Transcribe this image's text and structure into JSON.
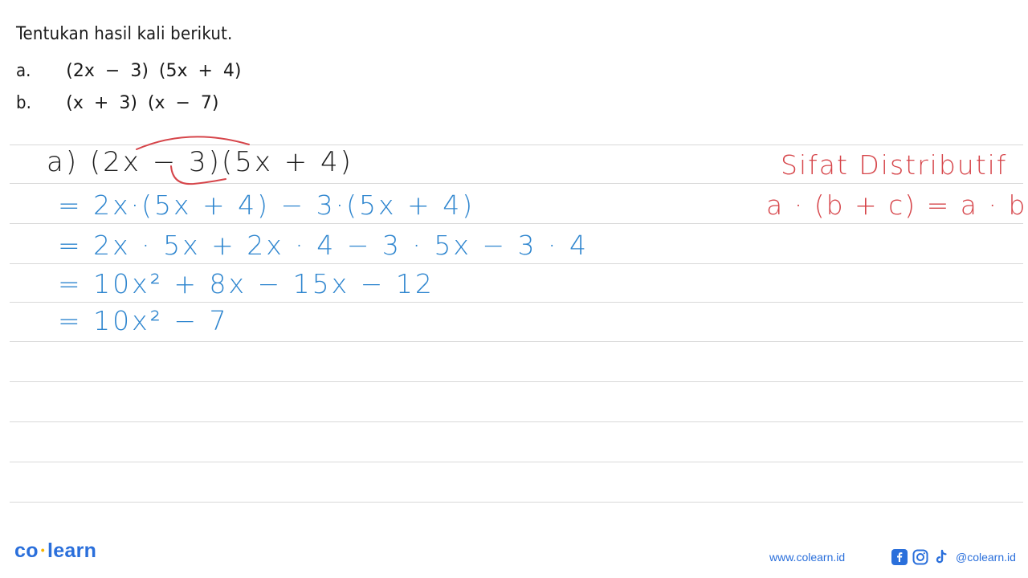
{
  "question": {
    "title": "Tentukan hasil kali berikut.",
    "items": [
      {
        "label": "a.",
        "expression": "(2x − 3) (5x + 4)"
      },
      {
        "label": "b.",
        "expression": "(x + 3) (x − 7)"
      }
    ]
  },
  "solution": {
    "header": "a)  (2x − 3)(5x + 4)",
    "steps": [
      "= 2x·(5x + 4) − 3·(5x + 4)",
      "= 2x · 5x + 2x · 4 − 3 · 5x − 3 · 4",
      "= 10x² + 8x − 15x − 12",
      "= 10x² − 7"
    ]
  },
  "note": {
    "title": "Sifat Distributif",
    "formula": "a · (b + c) = a · b + a · c"
  },
  "footer": {
    "logo_left": "co",
    "logo_right": "learn",
    "website": "www.colearn.id",
    "social_handle": "@colearn.id",
    "icons": [
      "facebook-icon",
      "instagram-icon",
      "tiktok-icon"
    ]
  },
  "colors": {
    "ink_black": "#1b1b1b",
    "ink_blue": "#2f86cf",
    "ink_red": "#d6454a",
    "brand_blue": "#2a6fdb",
    "brand_yellow": "#f5b400"
  }
}
